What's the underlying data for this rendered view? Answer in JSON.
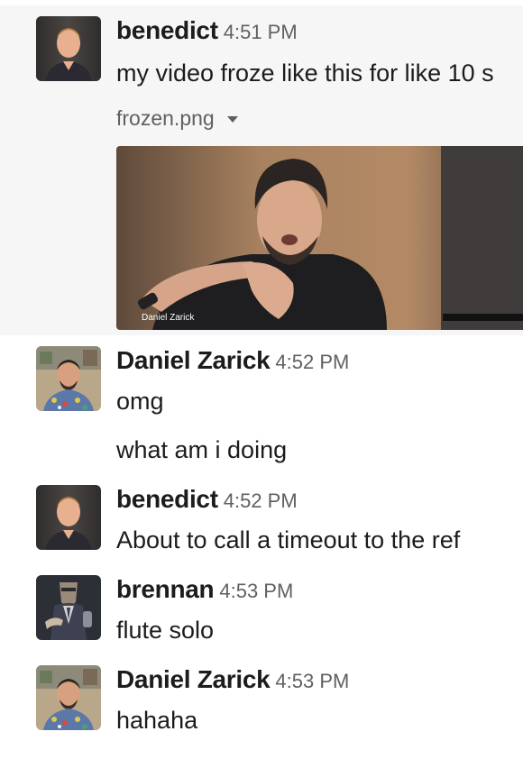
{
  "messages": [
    {
      "sender": "benedict",
      "time": "4:51 PM",
      "text": "my video froze like this for like 10 s",
      "attachment": {
        "filename": "frozen.png",
        "video_caption": "Daniel Zarick"
      }
    },
    {
      "sender": "Daniel Zarick",
      "time": "4:52 PM",
      "lines": [
        "omg",
        "what am i doing"
      ]
    },
    {
      "sender": "benedict",
      "time": "4:52 PM",
      "text": "About to call a timeout to the ref"
    },
    {
      "sender": "brennan",
      "time": "4:53 PM",
      "text": "flute solo"
    },
    {
      "sender": "Daniel Zarick",
      "time": "4:53 PM",
      "text": "hahaha"
    }
  ]
}
